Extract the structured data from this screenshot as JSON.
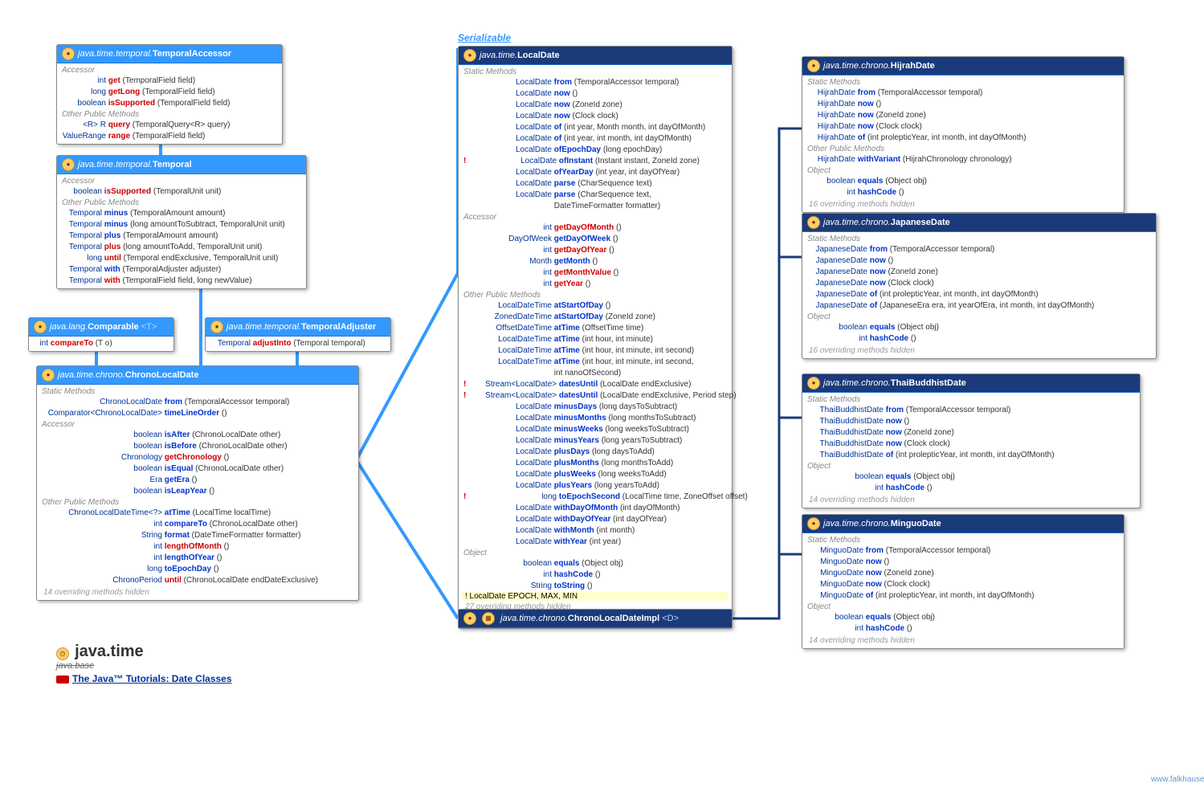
{
  "serializable": "Serializable",
  "title": {
    "main": "java.time",
    "sub": "java.base",
    "tutorial": "The Java™ Tutorials: Date Classes",
    "credit": "www.falkhausen.de"
  },
  "boxes": {
    "temporalaccessor": {
      "pkg": "java.time.temporal.",
      "cls": "TemporalAccessor",
      "sections": [
        {
          "name": "Accessor",
          "rows": [
            {
              "ret": "int",
              "m": "get",
              "a": "(TemporalField field)"
            },
            {
              "ret": "long",
              "m": "getLong",
              "a": "(TemporalField field)"
            },
            {
              "ret": "boolean",
              "m": "isSupported",
              "a": "(TemporalField field)"
            }
          ]
        },
        {
          "name": "Other Public Methods",
          "rows": [
            {
              "ret": "<R> R",
              "m": "query",
              "a": "(TemporalQuery<R> query)"
            },
            {
              "ret": "ValueRange",
              "m": "range",
              "a": "(TemporalField field)"
            }
          ]
        }
      ]
    },
    "temporal": {
      "pkg": "java.time.temporal.",
      "cls": "Temporal",
      "sections": [
        {
          "name": "Accessor",
          "rows": [
            {
              "ret": "boolean",
              "m": "isSupported",
              "a": "(TemporalUnit unit)"
            }
          ]
        },
        {
          "name": "Other Public Methods",
          "rows": [
            {
              "ret": "Temporal",
              "m": "minus",
              "a": "(TemporalAmount amount)",
              "b": 1
            },
            {
              "ret": "Temporal",
              "m": "minus",
              "a": "(long amountToSubtract, TemporalUnit unit)",
              "b": 1
            },
            {
              "ret": "Temporal",
              "m": "plus",
              "a": "(TemporalAmount amount)",
              "b": 1
            },
            {
              "ret": "Temporal",
              "m": "plus",
              "a": "(long amountToAdd, TemporalUnit unit)"
            },
            {
              "ret": "long",
              "m": "until",
              "a": "(Temporal endExclusive, TemporalUnit unit)"
            },
            {
              "ret": "Temporal",
              "m": "with",
              "a": "(TemporalAdjuster adjuster)",
              "b": 1
            },
            {
              "ret": "Temporal",
              "m": "with",
              "a": "(TemporalField field, long newValue)"
            }
          ]
        }
      ]
    },
    "comparable": {
      "pkg": "java.lang.",
      "cls": "Comparable",
      "gen": "<T>",
      "rows": [
        {
          "ret": "int",
          "m": "compareTo",
          "a": "(T o)"
        }
      ]
    },
    "temporaladjuster": {
      "pkg": "java.time.temporal.",
      "cls": "TemporalAdjuster",
      "rows": [
        {
          "ret": "Temporal",
          "m": "adjustInto",
          "a": "(Temporal temporal)"
        }
      ]
    },
    "chronolocaldate": {
      "pkg": "java.time.chrono.",
      "cls": "ChronoLocalDate",
      "sections": [
        {
          "name": "Static Methods",
          "rows": [
            {
              "ret": "ChronoLocalDate",
              "m": "from",
              "a": "(TemporalAccessor temporal)",
              "b": 1
            },
            {
              "ret": "Comparator<ChronoLocalDate>",
              "m": "timeLineOrder",
              "a": "()",
              "b": 1
            }
          ]
        },
        {
          "name": "Accessor",
          "rows": [
            {
              "ret": "boolean",
              "m": "isAfter",
              "a": "(ChronoLocalDate other)",
              "b": 1
            },
            {
              "ret": "boolean",
              "m": "isBefore",
              "a": "(ChronoLocalDate other)",
              "b": 1
            },
            {
              "ret": "Chronology",
              "m": "getChronology",
              "a": "()"
            },
            {
              "ret": "boolean",
              "m": "isEqual",
              "a": "(ChronoLocalDate other)",
              "b": 1
            },
            {
              "ret": "Era",
              "m": "getEra",
              "a": "()",
              "b": 1
            },
            {
              "ret": "boolean",
              "m": "isLeapYear",
              "a": "()",
              "b": 1
            }
          ]
        },
        {
          "name": "Other Public Methods",
          "rows": [
            {
              "ret": "ChronoLocalDateTime<?>",
              "m": "atTime",
              "a": "(LocalTime localTime)",
              "b": 1
            },
            {
              "ret": "int",
              "m": "compareTo",
              "a": "(ChronoLocalDate other)",
              "b": 1
            },
            {
              "ret": "String",
              "m": "format",
              "a": "(DateTimeFormatter formatter)",
              "b": 1
            },
            {
              "ret": "int",
              "m": "lengthOfMonth",
              "a": "()"
            },
            {
              "ret": "int",
              "m": "lengthOfYear",
              "a": "()",
              "b": 1
            },
            {
              "ret": "long",
              "m": "toEpochDay",
              "a": "()",
              "b": 1
            },
            {
              "ret": "ChronoPeriod",
              "m": "until",
              "a": "(ChronoLocalDate endDateExclusive)"
            }
          ]
        }
      ],
      "hidden": "14 overriding methods hidden"
    },
    "localdate": {
      "pkg": "java.time.",
      "cls": "LocalDate",
      "sections": [
        {
          "name": "Static Methods",
          "rows": [
            {
              "ret": "LocalDate",
              "m": "from",
              "a": "(TemporalAccessor temporal)",
              "b": 1
            },
            {
              "ret": "LocalDate",
              "m": "now",
              "a": "()",
              "b": 1
            },
            {
              "ret": "LocalDate",
              "m": "now",
              "a": "(ZoneId zone)",
              "b": 1
            },
            {
              "ret": "LocalDate",
              "m": "now",
              "a": "(Clock clock)",
              "b": 1
            },
            {
              "ret": "LocalDate",
              "m": "of",
              "a": "(int year, Month month, int dayOfMonth)",
              "b": 1
            },
            {
              "ret": "LocalDate",
              "m": "of",
              "a": "(int year, int month, int dayOfMonth)",
              "b": 1
            },
            {
              "ret": "LocalDate",
              "m": "ofEpochDay",
              "a": "(long epochDay)",
              "b": 1
            },
            {
              "ret": "LocalDate",
              "m": "ofInstant",
              "a": "(Instant instant, ZoneId zone)",
              "bang": 1,
              "b": 1
            },
            {
              "ret": "LocalDate",
              "m": "ofYearDay",
              "a": "(int year, int dayOfYear)",
              "b": 1
            },
            {
              "ret": "LocalDate",
              "m": "parse",
              "a": "(CharSequence text)",
              "b": 1
            },
            {
              "ret": "LocalDate",
              "m": "parse",
              "a": "(CharSequence text,",
              "b": 1
            },
            {
              "ret": "",
              "m": "",
              "a": "                   DateTimeFormatter formatter)"
            }
          ]
        },
        {
          "name": "Accessor",
          "rows": [
            {
              "ret": "int",
              "m": "getDayOfMonth",
              "a": "()"
            },
            {
              "ret": "DayOfWeek",
              "m": "getDayOfWeek",
              "a": "()",
              "b": 1
            },
            {
              "ret": "int",
              "m": "getDayOfYear",
              "a": "()"
            },
            {
              "ret": "Month",
              "m": "getMonth",
              "a": "()",
              "b": 1
            },
            {
              "ret": "int",
              "m": "getMonthValue",
              "a": "()"
            },
            {
              "ret": "int",
              "m": "getYear",
              "a": "()"
            }
          ]
        },
        {
          "name": "Other Public Methods",
          "rows": [
            {
              "ret": "LocalDateTime",
              "m": "atStartOfDay",
              "a": "()",
              "b": 1
            },
            {
              "ret": "ZonedDateTime",
              "m": "atStartOfDay",
              "a": "(ZoneId zone)",
              "b": 1
            },
            {
              "ret": "OffsetDateTime",
              "m": "atTime",
              "a": "(OffsetTime time)",
              "b": 1
            },
            {
              "ret": "LocalDateTime",
              "m": "atTime",
              "a": "(int hour, int minute)",
              "b": 1
            },
            {
              "ret": "LocalDateTime",
              "m": "atTime",
              "a": "(int hour, int minute, int second)",
              "b": 1
            },
            {
              "ret": "LocalDateTime",
              "m": "atTime",
              "a": "(int hour, int minute, int second,",
              "b": 1
            },
            {
              "ret": "",
              "m": "",
              "a": "                   int nanoOfSecond)"
            },
            {
              "ret": "Stream<LocalDate>",
              "m": "datesUntil",
              "a": "(LocalDate endExclusive)",
              "bang": 1,
              "b": 1
            },
            {
              "ret": "Stream<LocalDate>",
              "m": "datesUntil",
              "a": "(LocalDate endExclusive, Period step)",
              "bang": 1,
              "b": 1
            },
            {
              "ret": "LocalDate",
              "m": "minusDays",
              "a": "(long daysToSubtract)",
              "b": 1
            },
            {
              "ret": "LocalDate",
              "m": "minusMonths",
              "a": "(long monthsToSubtract)",
              "b": 1
            },
            {
              "ret": "LocalDate",
              "m": "minusWeeks",
              "a": "(long weeksToSubtract)",
              "b": 1
            },
            {
              "ret": "LocalDate",
              "m": "minusYears",
              "a": "(long yearsToSubtract)",
              "b": 1
            },
            {
              "ret": "LocalDate",
              "m": "plusDays",
              "a": "(long daysToAdd)",
              "b": 1
            },
            {
              "ret": "LocalDate",
              "m": "plusMonths",
              "a": "(long monthsToAdd)",
              "b": 1
            },
            {
              "ret": "LocalDate",
              "m": "plusWeeks",
              "a": "(long weeksToAdd)",
              "b": 1
            },
            {
              "ret": "LocalDate",
              "m": "plusYears",
              "a": "(long yearsToAdd)",
              "b": 1
            },
            {
              "ret": "long",
              "m": "toEpochSecond",
              "a": "(LocalTime time, ZoneOffset offset)",
              "bang": 1,
              "b": 1
            },
            {
              "ret": "LocalDate",
              "m": "withDayOfMonth",
              "a": "(int dayOfMonth)",
              "b": 1
            },
            {
              "ret": "LocalDate",
              "m": "withDayOfYear",
              "a": "(int dayOfYear)",
              "b": 1
            },
            {
              "ret": "LocalDate",
              "m": "withMonth",
              "a": "(int month)",
              "b": 1
            },
            {
              "ret": "LocalDate",
              "m": "withYear",
              "a": "(int year)",
              "b": 1
            }
          ]
        },
        {
          "name": "Object",
          "rows": [
            {
              "ret": "boolean",
              "m": "equals",
              "a": "(Object obj)",
              "b": 1
            },
            {
              "ret": "int",
              "m": "hashCode",
              "a": "()",
              "b": 1
            },
            {
              "ret": "String",
              "m": "toString",
              "a": "()",
              "b": 1
            }
          ]
        }
      ],
      "static": "! LocalDate EPOCH, MAX, MIN",
      "hidden": "27 overriding methods hidden"
    },
    "chronolocaldateimpl": {
      "pkg": "java.time.chrono.",
      "cls": "ChronoLocalDateImpl",
      "gen": "<D>"
    },
    "hijrah": {
      "pkg": "java.time.chrono.",
      "cls": "HijrahDate",
      "sections": [
        {
          "name": "Static Methods",
          "rows": [
            {
              "ret": "HijrahDate",
              "m": "from",
              "a": "(TemporalAccessor temporal)",
              "b": 1
            },
            {
              "ret": "HijrahDate",
              "m": "now",
              "a": "()",
              "b": 1
            },
            {
              "ret": "HijrahDate",
              "m": "now",
              "a": "(ZoneId zone)",
              "b": 1
            },
            {
              "ret": "HijrahDate",
              "m": "now",
              "a": "(Clock clock)",
              "b": 1
            },
            {
              "ret": "HijrahDate",
              "m": "of",
              "a": "(int prolepticYear, int month, int dayOfMonth)",
              "b": 1
            }
          ]
        },
        {
          "name": "Other Public Methods",
          "rows": [
            {
              "ret": "HijrahDate",
              "m": "withVariant",
              "a": "(HijrahChronology chronology)",
              "b": 1
            }
          ]
        },
        {
          "name": "Object",
          "rows": [
            {
              "ret": "boolean",
              "m": "equals",
              "a": "(Object obj)",
              "b": 1
            },
            {
              "ret": "int",
              "m": "hashCode",
              "a": "()",
              "b": 1
            }
          ]
        }
      ],
      "hidden": "16 overriding methods hidden"
    },
    "japanese": {
      "pkg": "java.time.chrono.",
      "cls": "JapaneseDate",
      "sections": [
        {
          "name": "Static Methods",
          "rows": [
            {
              "ret": "JapaneseDate",
              "m": "from",
              "a": "(TemporalAccessor temporal)",
              "b": 1
            },
            {
              "ret": "JapaneseDate",
              "m": "now",
              "a": "()",
              "b": 1
            },
            {
              "ret": "JapaneseDate",
              "m": "now",
              "a": "(ZoneId zone)",
              "b": 1
            },
            {
              "ret": "JapaneseDate",
              "m": "now",
              "a": "(Clock clock)",
              "b": 1
            },
            {
              "ret": "JapaneseDate",
              "m": "of",
              "a": "(int prolepticYear, int month, int dayOfMonth)",
              "b": 1
            },
            {
              "ret": "JapaneseDate",
              "m": "of",
              "a": "(JapaneseEra era, int yearOfEra, int month, int dayOfMonth)",
              "b": 1
            }
          ]
        },
        {
          "name": "Object",
          "rows": [
            {
              "ret": "boolean",
              "m": "equals",
              "a": "(Object obj)",
              "b": 1
            },
            {
              "ret": "int",
              "m": "hashCode",
              "a": "()",
              "b": 1
            }
          ]
        }
      ],
      "hidden": "16 overriding methods hidden"
    },
    "thai": {
      "pkg": "java.time.chrono.",
      "cls": "ThaiBuddhistDate",
      "sections": [
        {
          "name": "Static Methods",
          "rows": [
            {
              "ret": "ThaiBuddhistDate",
              "m": "from",
              "a": "(TemporalAccessor temporal)",
              "b": 1
            },
            {
              "ret": "ThaiBuddhistDate",
              "m": "now",
              "a": "()",
              "b": 1
            },
            {
              "ret": "ThaiBuddhistDate",
              "m": "now",
              "a": "(ZoneId zone)",
              "b": 1
            },
            {
              "ret": "ThaiBuddhistDate",
              "m": "now",
              "a": "(Clock clock)",
              "b": 1
            },
            {
              "ret": "ThaiBuddhistDate",
              "m": "of",
              "a": "(int prolepticYear, int month, int dayOfMonth)",
              "b": 1
            }
          ]
        },
        {
          "name": "Object",
          "rows": [
            {
              "ret": "boolean",
              "m": "equals",
              "a": "(Object obj)",
              "b": 1
            },
            {
              "ret": "int",
              "m": "hashCode",
              "a": "()",
              "b": 1
            }
          ]
        }
      ],
      "hidden": "14 overriding methods hidden"
    },
    "minguo": {
      "pkg": "java.time.chrono.",
      "cls": "MinguoDate",
      "sections": [
        {
          "name": "Static Methods",
          "rows": [
            {
              "ret": "MinguoDate",
              "m": "from",
              "a": "(TemporalAccessor temporal)",
              "b": 1
            },
            {
              "ret": "MinguoDate",
              "m": "now",
              "a": "()",
              "b": 1
            },
            {
              "ret": "MinguoDate",
              "m": "now",
              "a": "(ZoneId zone)",
              "b": 1
            },
            {
              "ret": "MinguoDate",
              "m": "now",
              "a": "(Clock clock)",
              "b": 1
            },
            {
              "ret": "MinguoDate",
              "m": "of",
              "a": "(int prolepticYear, int month, int dayOfMonth)",
              "b": 1
            }
          ]
        },
        {
          "name": "Object",
          "rows": [
            {
              "ret": "boolean",
              "m": "equals",
              "a": "(Object obj)",
              "b": 1
            },
            {
              "ret": "int",
              "m": "hashCode",
              "a": "()",
              "b": 1
            }
          ]
        }
      ],
      "hidden": "14 overriding methods hidden"
    }
  }
}
